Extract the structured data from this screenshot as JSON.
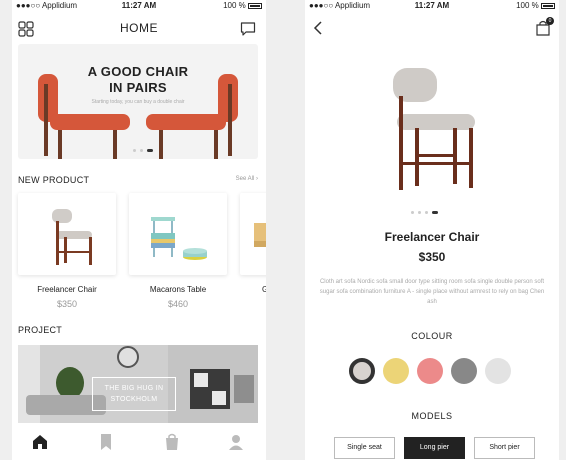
{
  "status": {
    "carrier": "Applidium",
    "time": "11:27 AM",
    "battery": "100 %"
  },
  "home": {
    "title": "HOME",
    "hero": {
      "title_line1": "A GOOD CHAIR",
      "title_line2": "IN PAIRS",
      "subtitle": "Starting today, you can buy a double chair"
    },
    "new_product": {
      "title": "NEW PRODUCT",
      "see_all": "See All",
      "items": [
        {
          "name": "Freelancer Chair",
          "price": "$350"
        },
        {
          "name": "Macarons Table",
          "price": "$460"
        },
        {
          "name": "Gu"
        }
      ]
    },
    "project": {
      "title": "PROJECT",
      "label_line1": "THE BIG HUG IN",
      "label_line2": "STOCKHOLM"
    },
    "tabs": [
      "home-icon",
      "bookmark-icon",
      "bag-icon",
      "profile-icon"
    ]
  },
  "detail": {
    "cart_count": "0",
    "name": "Freelancer Chair",
    "price": "$350",
    "description": "Cloth art sofa Nordic sofa small door type sitting room sofa single double person soft sugar sofa combination furniture A - single place without armrest to rely on bag Chen ash",
    "colour_title": "COLOUR",
    "colours": [
      "#d8d3cf",
      "#ecd477",
      "#ec8a8a",
      "#888888",
      "#e3e3e3"
    ],
    "selected_colour": 0,
    "models_title": "MODELS",
    "models": [
      "Single seat",
      "Long pier",
      "Short pier"
    ],
    "selected_model": 1
  }
}
